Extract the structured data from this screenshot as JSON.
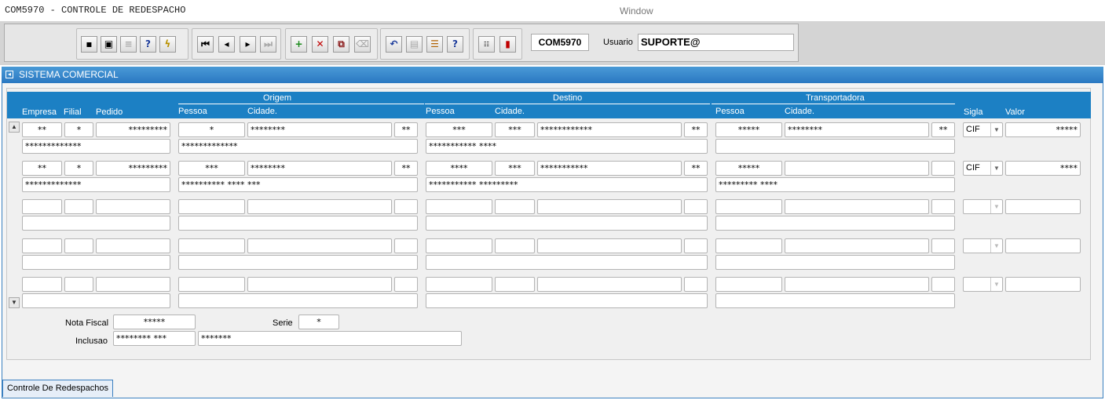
{
  "app": {
    "title": "COM5970 - CONTROLE DE REDESPACHO",
    "window_title": "Window",
    "form_name": "COM5970",
    "user_label": "Usuario",
    "user_value": "SUPORTE@"
  },
  "toolbar": {
    "groups": [
      {
        "buttons": [
          "save-icon",
          "print-screen-icon",
          "print-icon",
          "query-help-icon",
          "execute-query-icon"
        ]
      },
      {
        "buttons": [
          "first-record-icon",
          "previous-record-icon",
          "next-record-icon",
          "last-record-icon"
        ]
      },
      {
        "buttons": [
          "insert-record-icon",
          "delete-record-icon",
          "duplicate-record-icon",
          "clear-record-icon"
        ]
      },
      {
        "buttons": [
          "undo-icon",
          "clipboard-icon",
          "list-values-icon",
          "help-icon"
        ]
      },
      {
        "buttons": [
          "menu-icon",
          "exit-icon"
        ]
      }
    ]
  },
  "window": {
    "title": "SISTEMA COMERCIAL"
  },
  "grid": {
    "groups": {
      "origem": "Origem",
      "destino": "Destino",
      "transportadora": "Transportadora"
    },
    "columns": {
      "empresa": "Empresa",
      "filial": "Filial",
      "pedido": "Pedido",
      "o_pessoa": "Pessoa",
      "o_cidade": "Cidade.",
      "d_pessoa": "Pessoa",
      "d_cidade": "Cidade.",
      "t_pessoa": "Pessoa",
      "t_cidade": "Cidade.",
      "sigla": "Sigla",
      "valor": "Valor"
    },
    "rows": [
      {
        "empresa": "**",
        "filial": "*",
        "pedido": "*********",
        "o_pessoa": "*",
        "o_cidade": "********",
        "o_uf": "**",
        "o_nome": "*************",
        "d_pessoa": "***",
        "d_cod": "***",
        "d_cidade": "************",
        "d_uf": "**",
        "d_nome": "*********** ****",
        "t_pessoa": "*****",
        "t_cidade": "********",
        "t_uf": "**",
        "t_nome": "",
        "sigla": "CIF",
        "valor": "*****",
        "empresa_nome": "*************"
      },
      {
        "empresa": "**",
        "filial": "*",
        "pedido": "*********",
        "o_pessoa": "***",
        "o_cidade": "********",
        "o_uf": "**",
        "o_nome": "********** **** ***",
        "d_pessoa": "****",
        "d_cod": "***",
        "d_cidade": "***********",
        "d_uf": "**",
        "d_nome": "***********  *********",
        "t_pessoa": "*****",
        "t_cidade": "",
        "t_uf": "",
        "t_nome": "********* ****",
        "sigla": "CIF",
        "valor": "****",
        "empresa_nome": "*************"
      },
      {
        "empty": true
      },
      {
        "empty": true
      },
      {
        "empty": true
      }
    ]
  },
  "footer": {
    "nota_fiscal_label": "Nota Fiscal",
    "nota_fiscal_value": "*****",
    "serie_label": "Serie",
    "serie_value": "*",
    "inclusao_label": "Inclusao",
    "inclusao_value": "******** ***",
    "inclusao_extra": "*******"
  },
  "tab": {
    "label": "Controle De Redespachos"
  }
}
